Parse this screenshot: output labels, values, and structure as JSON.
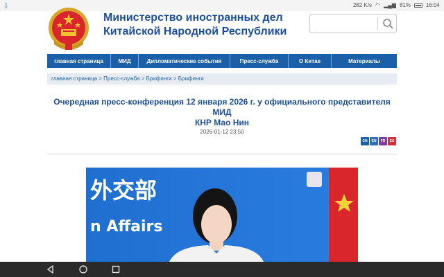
{
  "status_bar": {
    "net_speed": "282 K/s",
    "battery": "81%",
    "time": "16:04"
  },
  "header": {
    "ministry_line1": "Министерство иностранных дел",
    "ministry_line2": "Китайской Народной Республики",
    "search_placeholder": ""
  },
  "nav": {
    "items": [
      {
        "label": "главная страница"
      },
      {
        "label": "МИД"
      },
      {
        "label": "Дипломатические события"
      },
      {
        "label": "Пресс-служба"
      },
      {
        "label": "О Китае"
      },
      {
        "label": "Материалы"
      }
    ]
  },
  "breadcrumb": "главная страница > Пресс-служба > Брифинги > Брифинги",
  "article": {
    "title_line1": "Очередная пресс-конференция 12 января 2026 г. у официального представителя МИД",
    "title_line2": "КНР Мао Нин",
    "date": "2026-01-12 23:50"
  },
  "languages": [
    {
      "code": "CN",
      "color": "#1b5fa8"
    },
    {
      "code": "EN",
      "color": "#2d6fb8"
    },
    {
      "code": "FR",
      "color": "#7b3f99"
    },
    {
      "code": "ES",
      "color": "#d0303a"
    }
  ],
  "photo": {
    "backdrop_chars": "外交部",
    "backdrop_text": "n Affairs"
  },
  "colors": {
    "brand_blue": "#1b5fa8",
    "title_blue": "#1b4f9c",
    "flag_red": "#d8262c"
  }
}
